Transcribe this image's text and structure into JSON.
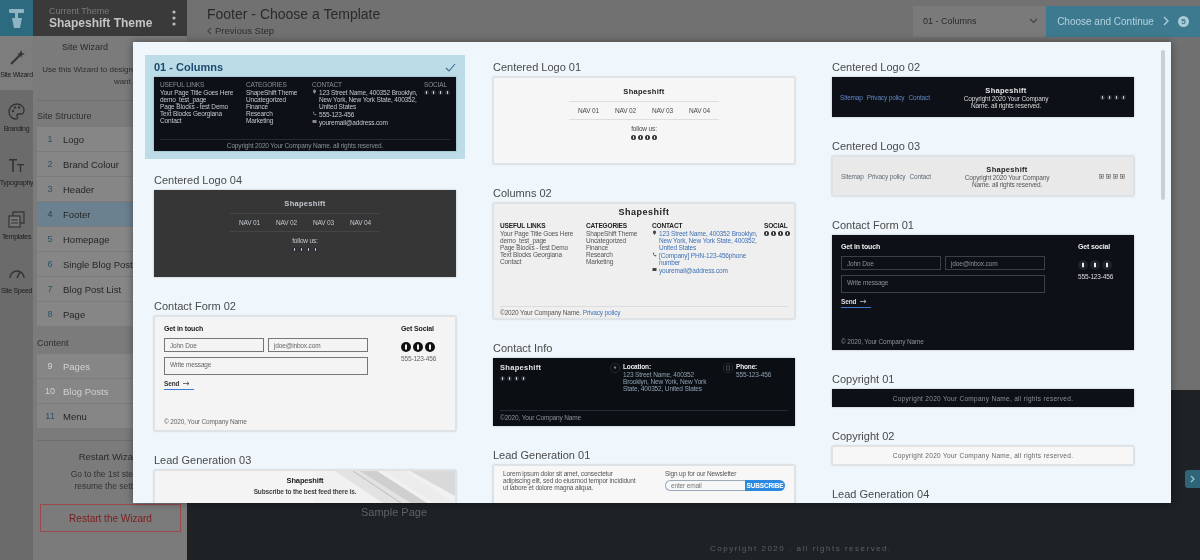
{
  "rail": {
    "items": [
      {
        "label": "Site Wizard",
        "selected": true
      },
      {
        "label": "Branding",
        "selected": false
      },
      {
        "label": "Typography",
        "selected": false
      },
      {
        "label": "Templates",
        "selected": false
      },
      {
        "label": "Site Speed",
        "selected": false
      }
    ]
  },
  "theme_header": {
    "caption": "Current Theme",
    "name": "Shapeshift Theme"
  },
  "wizard": {
    "title": "Site Wizard",
    "description": [
      "Use this Wizard to design",
      "want."
    ],
    "sections": [
      {
        "title": "Site Structure",
        "steps": [
          {
            "number": "1",
            "label": "Logo",
            "selected": false,
            "disabled": false
          },
          {
            "number": "2",
            "label": "Brand Colour",
            "selected": false,
            "disabled": false
          },
          {
            "number": "3",
            "label": "Header",
            "selected": false,
            "disabled": false
          },
          {
            "number": "4",
            "label": "Footer",
            "selected": true,
            "disabled": false
          },
          {
            "number": "5",
            "label": "Homepage",
            "selected": false,
            "disabled": false
          },
          {
            "number": "6",
            "label": "Single Blog Post",
            "selected": false,
            "disabled": false
          },
          {
            "number": "7",
            "label": "Blog Post List",
            "selected": false,
            "disabled": false
          },
          {
            "number": "8",
            "label": "Page",
            "selected": false,
            "disabled": false
          }
        ]
      },
      {
        "title": "Content",
        "steps": [
          {
            "number": "9",
            "label": "Pages",
            "selected": false,
            "disabled": true
          },
          {
            "number": "10",
            "label": "Blog Posts",
            "selected": false,
            "disabled": true
          },
          {
            "number": "11",
            "label": "Menu",
            "selected": false,
            "disabled": false
          }
        ]
      }
    ],
    "restart": {
      "title": "Restart Wiza",
      "lines": [
        "Go to the 1st ste",
        "resume the sett"
      ],
      "button": "Restart the Wizard"
    }
  },
  "topbar": {
    "title": "Footer - Choose a Template",
    "back_link": "Previous Step",
    "select": "01 - Columns",
    "button": "Choose and Continue",
    "badge": "5"
  },
  "page_behind": {
    "link": "Sample Page",
    "copyright": "Copyright 2020 . all rights reserved."
  },
  "modal": {
    "columns": [
      [
        {
          "name": "01 - Columns",
          "selected": true,
          "thumbnail": {
            "kind": "columns",
            "color": "#0d1117",
            "columns": [
              {
                "kind": "links",
                "heading": "USEFUL LINKS",
                "items": [
                  "Your Page Title Goes Here",
                  "demo_test_page",
                  "Page Blocks - test Demo",
                  "Text Blocks Georgiana",
                  "Contact"
                ]
              },
              {
                "kind": "links",
                "heading": "CATEGORIES",
                "items": [
                  "ShapeShift Theme",
                  "Uncategorized",
                  "Finance",
                  "Research",
                  "Marketing"
                ]
              },
              {
                "kind": "contact",
                "heading": "CONTACT",
                "items": [
                  "123 Street Name, 400352 Brooklyn, New York, New York State, 400352, United States",
                  "555-123-456",
                  "youremail@address.com"
                ]
              },
              {
                "kind": "social",
                "heading": "SOCIAL"
              }
            ],
            "copyright": "Copyright 2020 Your Company Name. all rights reserved."
          }
        },
        {
          "name": "Centered Logo 04",
          "selected": false,
          "thumbnail": {
            "kind": "centered",
            "color": "#363636",
            "logo": "Shapeshift",
            "nav": [
              "NAV 01",
              "NAV 02",
              "NAV 03",
              "NAV 04"
            ],
            "follow": "follow us:"
          }
        },
        {
          "name": "Contact Form 02",
          "selected": false,
          "thumbnail": {
            "kind": "contact_form",
            "color": "#f4f4f4",
            "heading": "Get in touch",
            "name_placeholder": "John Doe",
            "email_placeholder": "jdoe@inbox.com",
            "message_placeholder": "Write message",
            "send": "Send",
            "copyright": "© 2020, Your Company Name",
            "social_heading": "Get Social",
            "phone": "555-123-456"
          }
        },
        {
          "name": "Lead Generation 03",
          "selected": false,
          "thumbnail": {
            "kind": "lead_image",
            "color": "#f4f4f4",
            "logo": "Shapeshift",
            "subtitle": "Subscribe to the best feed there is."
          }
        }
      ],
      [
        {
          "name": "Centered Logo 01",
          "selected": false,
          "thumbnail": {
            "kind": "centered",
            "color": "#f6f6f6",
            "logo": "Shapeshift",
            "nav": [
              "NAV 01",
              "NAV 02",
              "NAV 03",
              "NAV 04"
            ],
            "follow": "follow us:"
          }
        },
        {
          "name": "Columns 02",
          "selected": false,
          "thumbnail": {
            "kind": "columns",
            "color": "#efefef",
            "logo": "Shapeshift",
            "columns": [
              {
                "kind": "links",
                "heading": "USEFUL LINKS",
                "items": [
                  "Your Page Title Goes Here",
                  "demo_test_page",
                  "Page Blocks - test Demo",
                  "Text Blocks Georgiana",
                  "Contact"
                ]
              },
              {
                "kind": "links",
                "heading": "CATEGORIES",
                "items": [
                  "ShapeShift Theme",
                  "Uncategorized",
                  "Finance",
                  "Research",
                  "Marketing"
                ]
              },
              {
                "kind": "contact",
                "heading": "CONTACT",
                "items": [
                  "123 Street Name, 400352 Brooklyn, New York, New York State, 400352, United States",
                  "[Company] PHN-123-456phone number",
                  "youremail@address.com"
                ]
              },
              {
                "kind": "social",
                "heading": "SOCIAL"
              }
            ],
            "copyright": "©2020 Your Company Name.",
            "copyright_link": "Privacy policy"
          }
        },
        {
          "name": "Contact Info",
          "selected": false,
          "thumbnail": {
            "kind": "contact_info",
            "color": "#0b0f14",
            "logo": "Shapeshift",
            "location_label": "Location:",
            "address": "123 Street Name, 400352 Brooklyn, New York, New York State, 400352, United States",
            "phone_label": "Phone:",
            "phone": "555-123-456",
            "copyright": "©2020, Your Company Name"
          }
        },
        {
          "name": "Lead Generation 01",
          "selected": false,
          "thumbnail": {
            "kind": "lead_newsletter",
            "color": "#f7f7f7",
            "body": "Lorem ipsum dolor sit amet, consectetur adipiscing elit, sed do eiusmod tempor incididunt ut labore et dolore magna aliqua.",
            "heading": "Sign up for our Newsletter",
            "placeholder": "enter email",
            "button": "SUBSCRIBE"
          }
        }
      ],
      [
        {
          "name": "Centered Logo 02",
          "selected": false,
          "thumbnail": {
            "kind": "centered_bar",
            "color": "#0d1117",
            "links": [
              "Sitemap",
              "Privacy policy",
              "Contact"
            ],
            "logo": "Shapeshift",
            "copyright": "Copyright 2020 Your Company Name. all rights reserved."
          }
        },
        {
          "name": "Centered Logo 03",
          "selected": false,
          "thumbnail": {
            "kind": "centered_bar",
            "color": "#e9e9e9",
            "links": [
              "Sitemap",
              "Privacy policy",
              "Contact"
            ],
            "logo": "Shapeshift",
            "copyright": "Copyright 2020 Your Company Name. all rights reserved."
          }
        },
        {
          "name": "Contact Form 01",
          "selected": false,
          "thumbnail": {
            "kind": "contact_form",
            "color": "#0d1117",
            "heading": "Get in touch",
            "name_placeholder": "John Doe",
            "email_placeholder": "jdoe@inbox.com",
            "message_placeholder": "Write message",
            "send": "Send",
            "copyright": "© 2020, Your Company Name",
            "social_heading": "Get social",
            "phone": "555-123-456"
          }
        },
        {
          "name": "Copyright 01",
          "selected": false,
          "thumbnail": {
            "kind": "copyright",
            "color": "#0d1117",
            "text": "Copyright 2020 Your Company Name, all rights reserved."
          }
        },
        {
          "name": "Copyright 02",
          "selected": false,
          "thumbnail": {
            "kind": "copyright",
            "color": "#f7f7f7",
            "text": "Copyright 2020 Your Company Name, all rights reserved."
          }
        },
        {
          "name": "Lead Generation 04",
          "selected": false
        }
      ]
    ]
  }
}
